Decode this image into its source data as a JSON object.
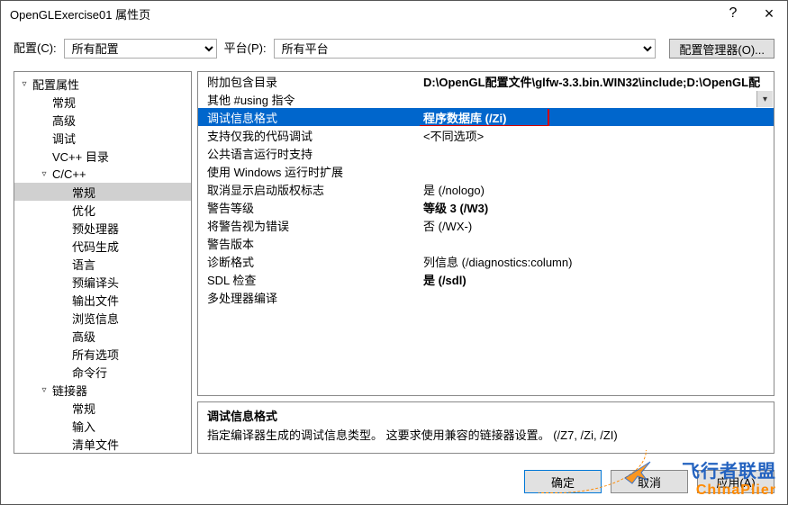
{
  "window": {
    "title": "OpenGLExercise01 属性页",
    "help_tooltip": "?",
    "close_tooltip": "×"
  },
  "toolbar": {
    "config_label": "配置(C):",
    "config_value": "所有配置",
    "platform_label": "平台(P):",
    "platform_value": "所有平台",
    "config_manager_label": "配置管理器(O)..."
  },
  "tree": [
    {
      "label": "配置属性",
      "indent": 0,
      "arrow": "▿",
      "selected": false,
      "interact": true
    },
    {
      "label": "常规",
      "indent": 1,
      "arrow": "",
      "selected": false,
      "interact": true
    },
    {
      "label": "高级",
      "indent": 1,
      "arrow": "",
      "selected": false,
      "interact": true
    },
    {
      "label": "调试",
      "indent": 1,
      "arrow": "",
      "selected": false,
      "interact": true
    },
    {
      "label": "VC++ 目录",
      "indent": 1,
      "arrow": "",
      "selected": false,
      "interact": true
    },
    {
      "label": "C/C++",
      "indent": 1,
      "arrow": "▿",
      "selected": false,
      "interact": true
    },
    {
      "label": "常规",
      "indent": 2,
      "arrow": "",
      "selected": true,
      "interact": true
    },
    {
      "label": "优化",
      "indent": 2,
      "arrow": "",
      "selected": false,
      "interact": true
    },
    {
      "label": "预处理器",
      "indent": 2,
      "arrow": "",
      "selected": false,
      "interact": true
    },
    {
      "label": "代码生成",
      "indent": 2,
      "arrow": "",
      "selected": false,
      "interact": true
    },
    {
      "label": "语言",
      "indent": 2,
      "arrow": "",
      "selected": false,
      "interact": true
    },
    {
      "label": "预编译头",
      "indent": 2,
      "arrow": "",
      "selected": false,
      "interact": true
    },
    {
      "label": "输出文件",
      "indent": 2,
      "arrow": "",
      "selected": false,
      "interact": true
    },
    {
      "label": "浏览信息",
      "indent": 2,
      "arrow": "",
      "selected": false,
      "interact": true
    },
    {
      "label": "高级",
      "indent": 2,
      "arrow": "",
      "selected": false,
      "interact": true
    },
    {
      "label": "所有选项",
      "indent": 2,
      "arrow": "",
      "selected": false,
      "interact": true
    },
    {
      "label": "命令行",
      "indent": 2,
      "arrow": "",
      "selected": false,
      "interact": true
    },
    {
      "label": "链接器",
      "indent": 1,
      "arrow": "▿",
      "selected": false,
      "interact": true
    },
    {
      "label": "常规",
      "indent": 2,
      "arrow": "",
      "selected": false,
      "interact": true
    },
    {
      "label": "输入",
      "indent": 2,
      "arrow": "",
      "selected": false,
      "interact": true
    },
    {
      "label": "清单文件",
      "indent": 2,
      "arrow": "",
      "selected": false,
      "interact": true
    }
  ],
  "properties": [
    {
      "name": "附加包含目录",
      "value": "D:\\OpenGL配置文件\\glfw-3.3.bin.WIN32\\include;D:\\OpenGL配",
      "bold": true,
      "selected": false,
      "highlight": false
    },
    {
      "name": "其他 #using 指令",
      "value": "",
      "bold": false,
      "selected": false,
      "highlight": false
    },
    {
      "name": "调试信息格式",
      "value": "程序数据库 (/Zi)",
      "bold": true,
      "selected": true,
      "highlight": true
    },
    {
      "name": "支持仅我的代码调试",
      "value": "<不同选项>",
      "bold": false,
      "selected": false,
      "highlight": false
    },
    {
      "name": "公共语言运行时支持",
      "value": "",
      "bold": false,
      "selected": false,
      "highlight": false
    },
    {
      "name": "使用 Windows 运行时扩展",
      "value": "",
      "bold": false,
      "selected": false,
      "highlight": false
    },
    {
      "name": "取消显示启动版权标志",
      "value": "是 (/nologo)",
      "bold": false,
      "selected": false,
      "highlight": false
    },
    {
      "name": "警告等级",
      "value": "等级 3 (/W3)",
      "bold": true,
      "selected": false,
      "highlight": false
    },
    {
      "name": "将警告视为错误",
      "value": "否 (/WX-)",
      "bold": false,
      "selected": false,
      "highlight": false
    },
    {
      "name": "警告版本",
      "value": "",
      "bold": false,
      "selected": false,
      "highlight": false
    },
    {
      "name": "诊断格式",
      "value": "列信息 (/diagnostics:column)",
      "bold": false,
      "selected": false,
      "highlight": false
    },
    {
      "name": "SDL 检查",
      "value": "是 (/sdl)",
      "bold": true,
      "selected": false,
      "highlight": false
    },
    {
      "name": "多处理器编译",
      "value": "",
      "bold": false,
      "selected": false,
      "highlight": false
    }
  ],
  "description": {
    "title": "调试信息格式",
    "body": "指定编译器生成的调试信息类型。  这要求使用兼容的链接器设置。     (/Z7, /Zi, /ZI)"
  },
  "buttons": {
    "ok": "确定",
    "cancel": "取消",
    "apply": "应用(A)"
  },
  "watermark": {
    "cn": "飞行者联盟",
    "en": "ChinaPlier"
  }
}
